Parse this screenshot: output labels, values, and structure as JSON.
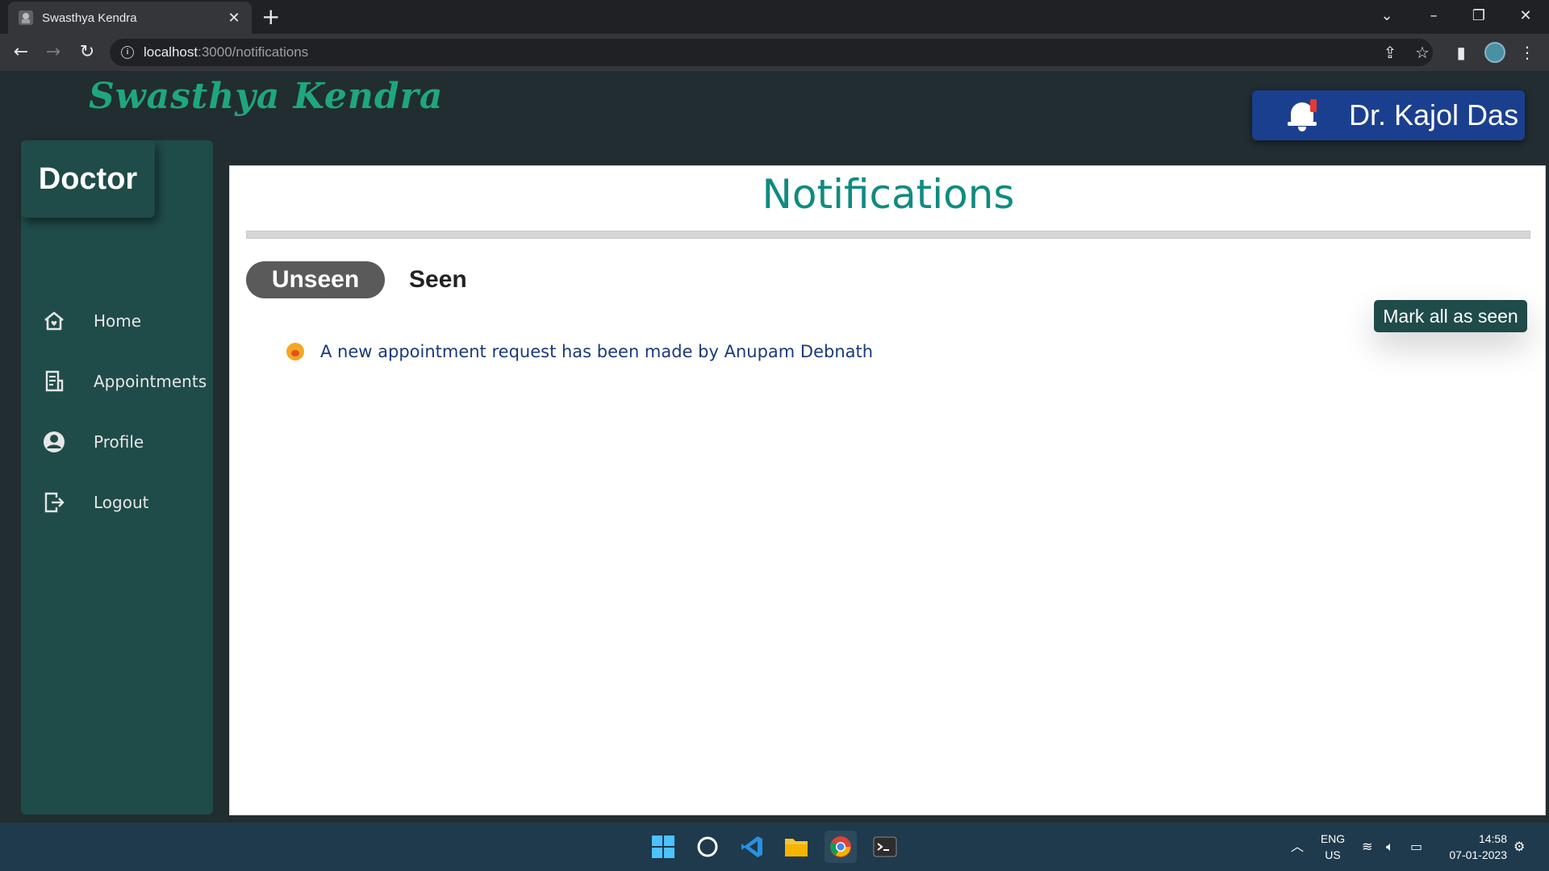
{
  "browser": {
    "tab_title": "Swasthya Kendra",
    "tab_close": "✕",
    "new_tab": "+",
    "url_host": "localhost",
    "url_path": ":3000/notifications"
  },
  "app": {
    "brand": "Swasthya Kendra",
    "user_name": "Dr. Kajol Das",
    "role": "Doctor",
    "accent_color": "#1fa67f",
    "sidebar_color": "#1f4b49",
    "user_box_color": "#1b3f8f"
  },
  "sidebar": {
    "items": [
      {
        "label": "Home",
        "icon": "home-icon"
      },
      {
        "label": "Appointments",
        "icon": "document-list-icon"
      },
      {
        "label": "Profile",
        "icon": "user-circle-icon"
      },
      {
        "label": "Logout",
        "icon": "logout-icon"
      }
    ]
  },
  "main": {
    "title": "Notifications",
    "tabs": [
      {
        "label": "Unseen",
        "active": true
      },
      {
        "label": "Seen",
        "active": false
      }
    ],
    "mark_all_label": "Mark all as seen",
    "notifications": [
      {
        "text": "A new appointment request has been made by Anupam Debnath",
        "icon": "emoji-icon"
      }
    ]
  },
  "taskbar": {
    "language": "ENG",
    "region": "US",
    "time": "14:58",
    "date": "07-01-2023"
  }
}
